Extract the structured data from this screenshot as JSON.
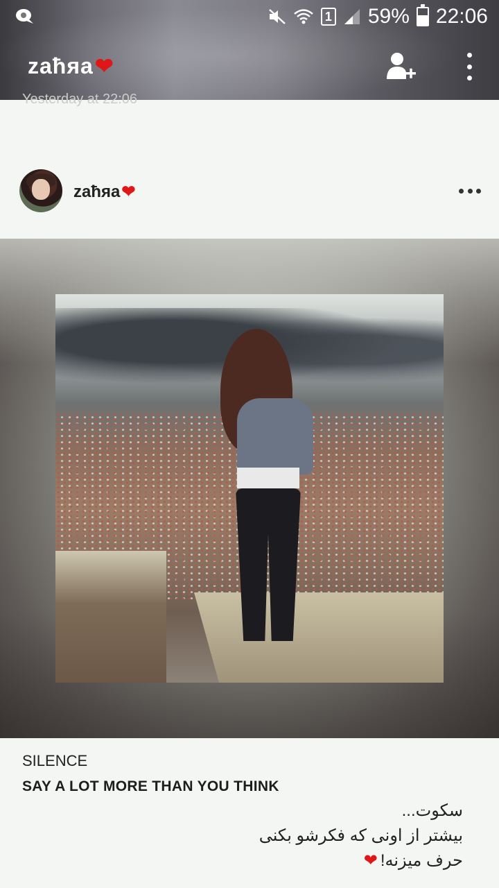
{
  "status_bar": {
    "left_icon": "chat-bubble-icon",
    "battery_level": 0.59,
    "battery": "59%",
    "sim": "1",
    "time": "22:06"
  },
  "app_bar": {
    "title": "zaħяa",
    "heart": "❤",
    "add_user_icon": "add-person-icon",
    "menu_icon": "overflow-menu-icon"
  },
  "faded_timestamp": "Yesterday at 22:06",
  "post": {
    "username": "zaħяa",
    "heart": "❤",
    "options_icon": "more-horizontal-icon"
  },
  "caption": {
    "line1": "SILENCE",
    "line2": "SAY A LOT MORE THAN YOU THINK",
    "fa_line1": "سکوت...",
    "fa_line2": "بیشتر از اونی که فکرشو بکنی",
    "fa_line3": "حرف میزنه!",
    "heart": "❤"
  },
  "colors": {
    "heart": "#e01717",
    "page_bg": "#f4f6f3"
  }
}
